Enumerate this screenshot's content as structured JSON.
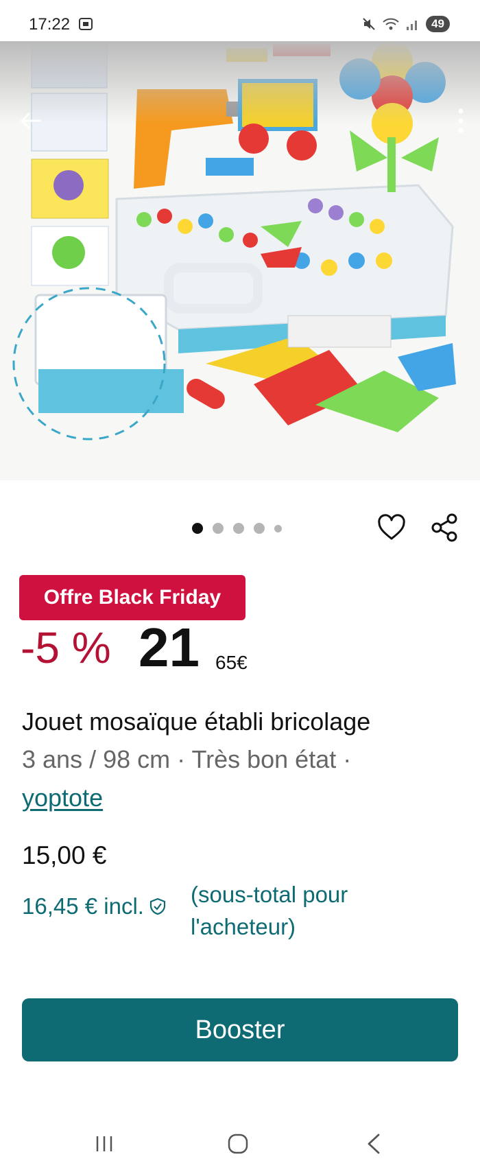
{
  "status_bar": {
    "time": "17:22",
    "battery": "49",
    "icons": [
      "screen-record-icon",
      "mute-icon",
      "wifi-icon",
      "signal-icon",
      "battery-icon"
    ]
  },
  "hero": {
    "image_alt": "",
    "back_icon": "arrow-left-icon",
    "more_icon": "more-vertical-icon",
    "carousel": {
      "total": 5,
      "active": 1
    }
  },
  "actions": {
    "favorite_icon": "heart-icon",
    "share_icon": "share-icon"
  },
  "promo": {
    "badge": "Offre Black Friday",
    "discount": "-5 %",
    "price_big": "21",
    "price_sup": "65€"
  },
  "item": {
    "title": "Jouet mosaïque établi bricolage",
    "meta": "3 ans / 98 cm · Très bon état ·",
    "seller": "yoptote"
  },
  "pricing": {
    "price": "15,00 €",
    "incl": "16,45 € incl.",
    "incl_note": "(sous-total pour l'acheteur)"
  },
  "cta": {
    "label": "Booster"
  },
  "colors": {
    "accent": "#0e6b73",
    "promo": "#cf1140",
    "discount": "#b31235"
  },
  "nav": {
    "icons": [
      "recent-apps-icon",
      "home-icon",
      "back-icon"
    ]
  }
}
